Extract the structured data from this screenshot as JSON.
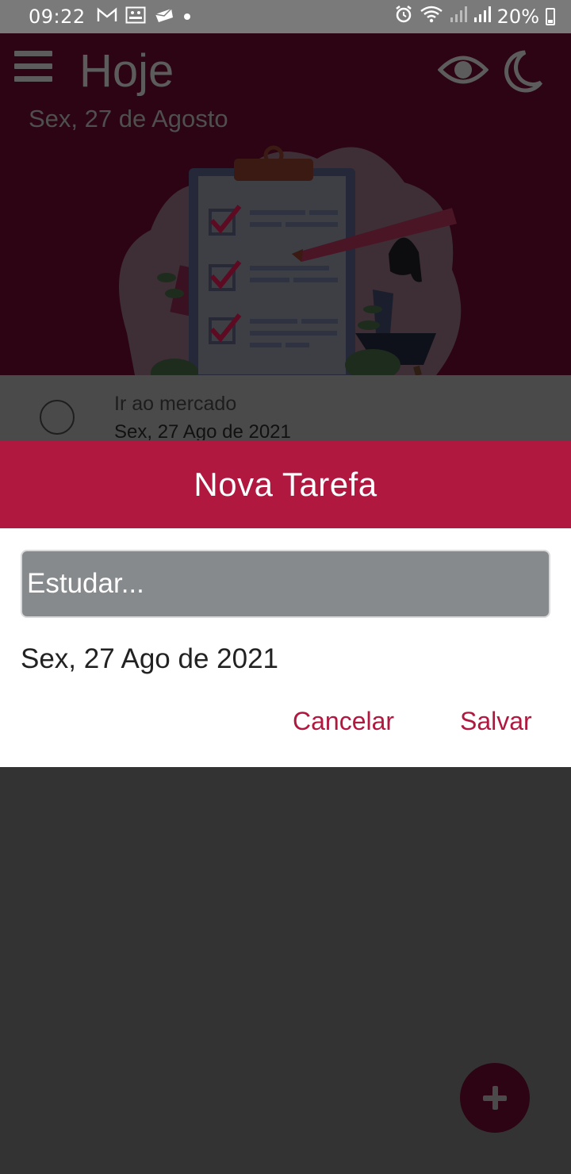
{
  "status_bar": {
    "time": "09:22",
    "notification_icons": [
      "gmail-icon",
      "gallery-icon",
      "mail-icon",
      "dot-icon"
    ],
    "battery_percent": "20%",
    "right_icons": [
      "alarm-icon",
      "wifi-icon",
      "signal-icon",
      "signal-icon",
      "battery-icon"
    ]
  },
  "header": {
    "title": "Hoje",
    "subtitle": "Sex, 27 de Agosto",
    "menu_icon": "menu-icon",
    "visibility_icon": "eye-icon",
    "theme_icon": "moon-icon"
  },
  "task_list": {
    "items": [
      {
        "title": "Ir ao mercado",
        "date": "Sex, 27 Ago de 2021"
      }
    ]
  },
  "dialog": {
    "title": "Nova Tarefa",
    "input_placeholder": "Estudar...",
    "input_value": "",
    "date": "Sex, 27 Ago de 2021",
    "cancel_label": "Cancelar",
    "save_label": "Salvar"
  },
  "fab": {
    "icon": "plus-icon"
  },
  "colors": {
    "accent": "#b01840",
    "header_dimmed": "#2c0413",
    "overlay_bg": "#333333",
    "input_bg": "#878a8d"
  }
}
